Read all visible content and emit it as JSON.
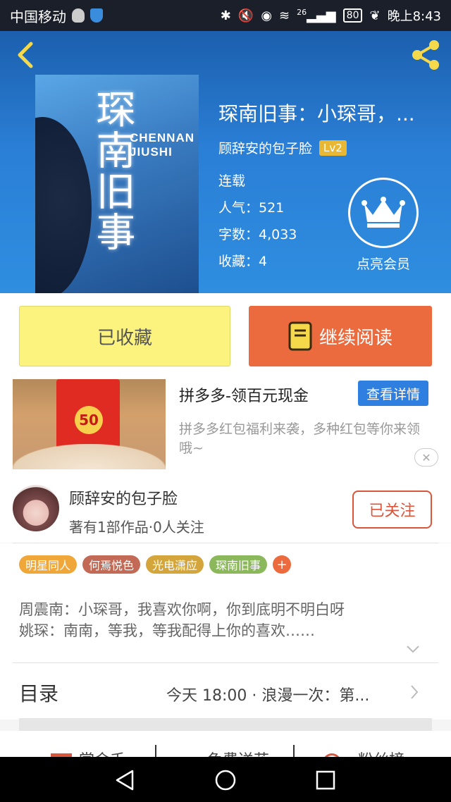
{
  "status_bar": {
    "carrier": "中国移动",
    "signal": "26",
    "battery": "80",
    "time": "晚上8:43"
  },
  "book": {
    "title": "琛南旧事：小琛哥，...",
    "cover_title": "琛南旧事",
    "cover_pinyin_1": "CHENNAN",
    "cover_pinyin_2": "JIUSHI",
    "author": "顾辞安的包子脸",
    "level": "Lv2",
    "status": "连载",
    "popularity": "人气：521",
    "word_count": "字数：4,033",
    "favorites": "收藏：4",
    "vip_label": "点亮会员"
  },
  "actions": {
    "collected_label": "已收藏",
    "continue_label": "继续阅读"
  },
  "ad": {
    "title": "拼多多-领百元现金",
    "detail_button": "查看详情",
    "description": "拼多多红包福利来袭，多种红包等你来领哦~",
    "coupon_value": "50",
    "close_icon": "close-icon"
  },
  "author_card": {
    "name": "顾辞安的包子脸",
    "meta": "著有1部作品·0人关注",
    "follow_label": "已关注"
  },
  "tags": [
    {
      "label": "明星同人",
      "color": "#f0a73a"
    },
    {
      "label": "何焉悦色",
      "color": "#c26a56"
    },
    {
      "label": "光电潇应",
      "color": "#d4a53a"
    },
    {
      "label": "琛南旧事",
      "color": "#8bb85a"
    }
  ],
  "tag_plus": "+",
  "summary": {
    "line1": "周震南：小琛哥，我喜欢你啊，你到底明不明白呀",
    "line2": "姚琛：南南，等我，等我配得上你的喜欢……"
  },
  "catalog": {
    "title": "目录",
    "latest": "今天 18:00 · 浪漫一次：第..."
  },
  "bottom_strip": {
    "item1": "赏金千",
    "item2": "免费送花",
    "item3": "粉丝榜"
  },
  "colors": {
    "header_blue": "#2a7fd6",
    "accent_orange": "#eb6a3e",
    "collected_yellow": "#fbf37e",
    "link_blue": "#2f7fe0",
    "follow_red": "#d9553b"
  }
}
